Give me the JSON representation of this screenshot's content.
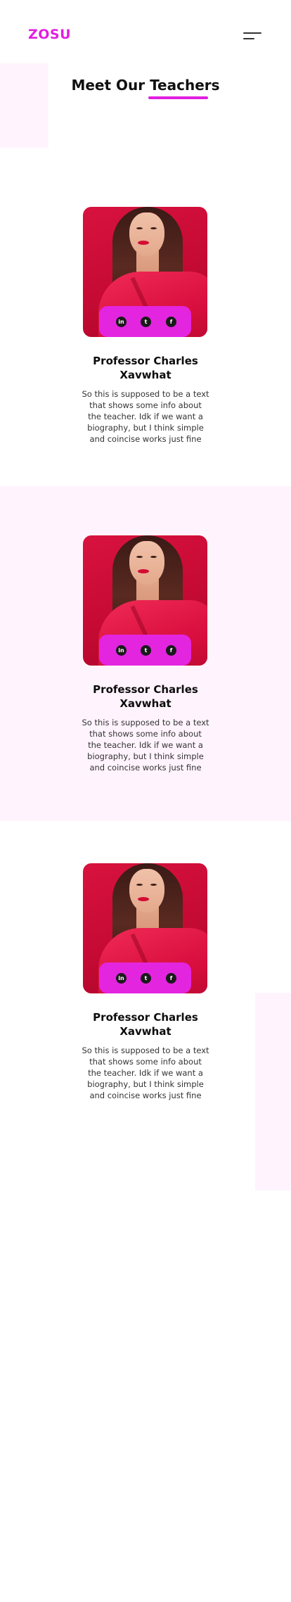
{
  "brand": {
    "logo": "ZOSU",
    "accent": "#e21ee0"
  },
  "header": {
    "menu_icon": "menu-icon"
  },
  "section": {
    "title": "Meet Our Teachers"
  },
  "teachers": [
    {
      "name_lines": [
        "Professor Charles",
        "Xavwhat"
      ],
      "bio_lines": [
        "So this is supposed to be a text",
        "that shows some info about",
        "the teacher. Idk if we want a",
        "biography, but I think simple",
        "and coincise works just fine"
      ],
      "social": {
        "linkedin": "in",
        "twitter": "t",
        "facebook": "f"
      }
    },
    {
      "name_lines": [
        "Professor Charles",
        "Xavwhat"
      ],
      "bio_lines": [
        "So this is supposed to be a text",
        "that shows some info about",
        "the teacher. Idk if we want a",
        "biography, but I think simple",
        "and coincise works just fine"
      ],
      "social": {
        "linkedin": "in",
        "twitter": "t",
        "facebook": "f"
      }
    },
    {
      "name_lines": [
        "Professor Charles",
        "Xavwhat"
      ],
      "bio_lines": [
        "So this is supposed to be a text",
        "that shows some info about",
        "the teacher. Idk if we want a",
        "biography, but I think simple",
        "and coincise works just fine"
      ],
      "social": {
        "linkedin": "in",
        "twitter": "t",
        "facebook": "f"
      }
    }
  ],
  "colors": {
    "pink_bg": "#fff4fd",
    "social_bar": "#e325e0",
    "photo_red": "#d8123e"
  }
}
